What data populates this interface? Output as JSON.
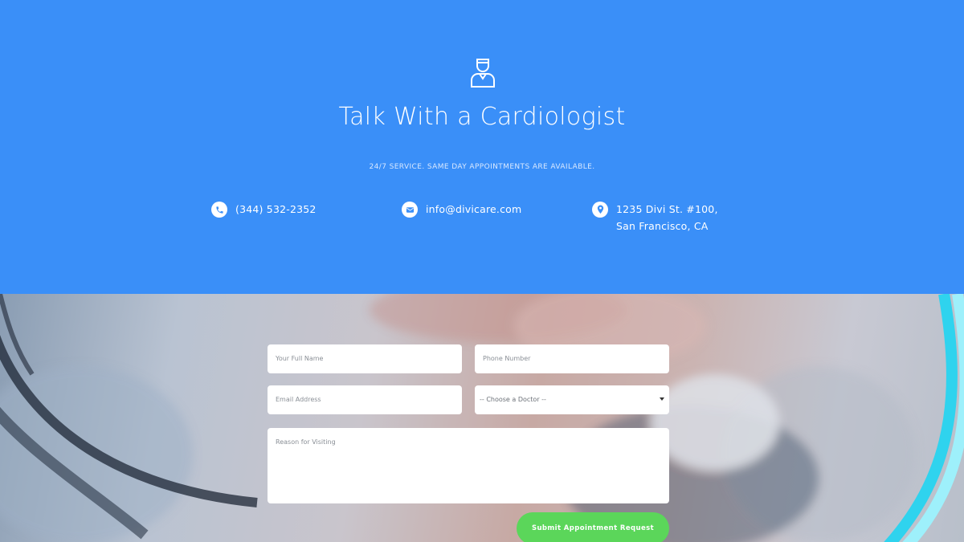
{
  "hero": {
    "icon": "doctor-icon",
    "title": "Talk With a Cardiologist",
    "subtitle": "24/7 SERVICE. SAME DAY APPOINTMENTS ARE AVAILABLE."
  },
  "contacts": [
    {
      "icon": "phone-icon",
      "text": "(344) 532-2352"
    },
    {
      "icon": "email-icon",
      "text": "info@divicare.com"
    },
    {
      "icon": "location-pin-icon",
      "text": "1235 Divi St. #100, San Francisco, CA"
    }
  ],
  "form": {
    "name_placeholder": "Your Full Name",
    "phone_placeholder": "Phone Number",
    "email_placeholder": "Email Address",
    "doctor_selected": "-- Choose a Doctor --",
    "reason_placeholder": "Reason for Visiting",
    "submit_label": "Submit Appointment Request"
  },
  "colors": {
    "hero_bg": "#3a8ff8",
    "submit_bg": "#5bd65a",
    "accent_curve": "#2fd3ee"
  }
}
